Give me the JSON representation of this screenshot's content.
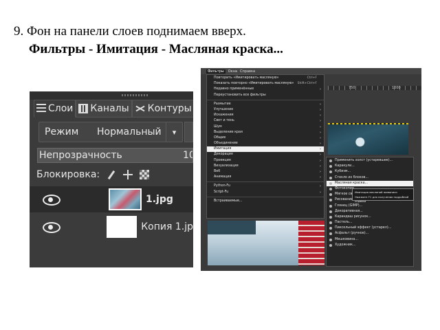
{
  "caption": {
    "line1": "9. Фон на панели слоев поднимаем вверх.",
    "line2": "Фильтры - Имитация - Масляная краска..."
  },
  "layers_panel": {
    "tabs": [
      {
        "label": "Слои",
        "icon": "layers-icon"
      },
      {
        "label": "Каналы",
        "icon": "channels-icon"
      },
      {
        "label": "Контуры",
        "icon": "paths-icon"
      }
    ],
    "mode_label": "Режим",
    "mode_value": "Нормальный",
    "opacity_label": "Непрозрачность",
    "opacity_value": "10",
    "lock_label": "Блокировка:",
    "layers": [
      {
        "name": "1.jpg",
        "visible": true,
        "selected": true
      },
      {
        "name": "Копия 1.jp",
        "visible": true,
        "selected": false
      }
    ]
  },
  "gimp_menu": {
    "menubar": [
      "Фильтры",
      "Окна",
      "Справка"
    ],
    "ruler_labels": [
      "750",
      "1000"
    ],
    "main_items": [
      {
        "label": "Повторить «Имитировать масляную»",
        "shortcut": "Ctrl+F"
      },
      {
        "label": "Показать повторно «Имитировать масляную»",
        "shortcut": "Shift+Ctrl+F"
      },
      {
        "label": "Недавно применённые",
        "arrow": true
      },
      {
        "label": "Переустановить все фильтры"
      },
      {
        "sep": true
      },
      {
        "label": "Размытие",
        "arrow": true
      },
      {
        "label": "Улучшение",
        "arrow": true
      },
      {
        "label": "Искажения",
        "arrow": true
      },
      {
        "label": "Свет и тень",
        "arrow": true
      },
      {
        "label": "Шум",
        "arrow": true
      },
      {
        "label": "Выделение края",
        "arrow": true
      },
      {
        "label": "Общие",
        "arrow": true
      },
      {
        "label": "Объединение",
        "arrow": true
      },
      {
        "label": "Имитация",
        "arrow": true,
        "highlight": true
      },
      {
        "label": "Декорация",
        "arrow": true
      },
      {
        "label": "Проекция",
        "arrow": true
      },
      {
        "label": "Визуализация",
        "arrow": true
      },
      {
        "label": "Веб",
        "arrow": true
      },
      {
        "label": "Анимация",
        "arrow": true
      },
      {
        "sep": true
      },
      {
        "label": "Python-Fu",
        "arrow": true
      },
      {
        "label": "Script-Fu",
        "arrow": true
      },
      {
        "sep": true
      },
      {
        "label": "Встраиваемые..."
      }
    ],
    "submenu_items": [
      {
        "label": "Применить холст (устаревшее)..."
      },
      {
        "label": "Каракули..."
      },
      {
        "label": "Кубизм..."
      },
      {
        "label": "Стекло из блоков..."
      },
      {
        "label": "Масляная краска...",
        "highlight": true
      },
      {
        "label": "Фотокопия..."
      },
      {
        "label": "Мягкое свечение..."
      },
      {
        "label": "Рисование тени..."
      },
      {
        "label": "Глянец (GIMP)..."
      },
      {
        "label": "Декоративная..."
      },
      {
        "label": "Карандаш рисунок..."
      },
      {
        "label": "Пастель..."
      },
      {
        "label": "Пиксельный эффект (устарел)..."
      },
      {
        "label": "Асфальт (ручное)..."
      },
      {
        "label": "Мешковина..."
      },
      {
        "label": "Художник..."
      }
    ],
    "tooltip": {
      "line1": "Имитация масляной живописи",
      "line2": "Нажмите F1 для получения подробной справки"
    }
  }
}
